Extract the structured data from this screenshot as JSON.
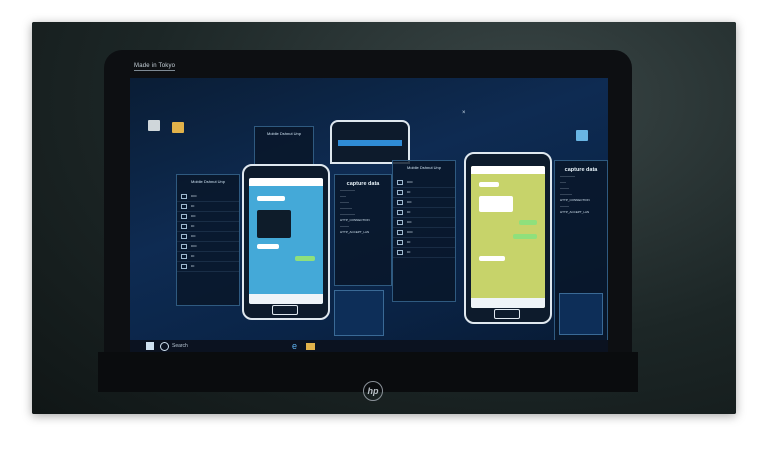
{
  "laptop": {
    "brand": "hp",
    "overlay_tag": "Made in Tokyo"
  },
  "desktop": {
    "icons": [
      {
        "name": "recycle-bin",
        "color": "#cfd6da"
      },
      {
        "name": "folder",
        "color": "#e2b24a"
      },
      {
        "name": "app",
        "color": "#69b5e3"
      }
    ],
    "taskbar_search": "Search"
  },
  "windows": {
    "back_left_title": "Mobile Dshnut Unp",
    "mid_left_title": "Mobile Dshnut Unp",
    "mid_right_title": "Mobile Dshnut Unp",
    "capture_title_left": "capture data",
    "capture_title_right": "capture data",
    "http_label": "HTTP_CONNECTION",
    "http_accept": "HTTP_ACCEPT_LAN"
  },
  "colors": {
    "screen_bg": "#0e2b52",
    "panel_border": "#2f5a80",
    "phone_left_screen": "#44a9d8",
    "phone_right_screen": "#c7d36a",
    "bubble_mine": "#8fe07c"
  }
}
